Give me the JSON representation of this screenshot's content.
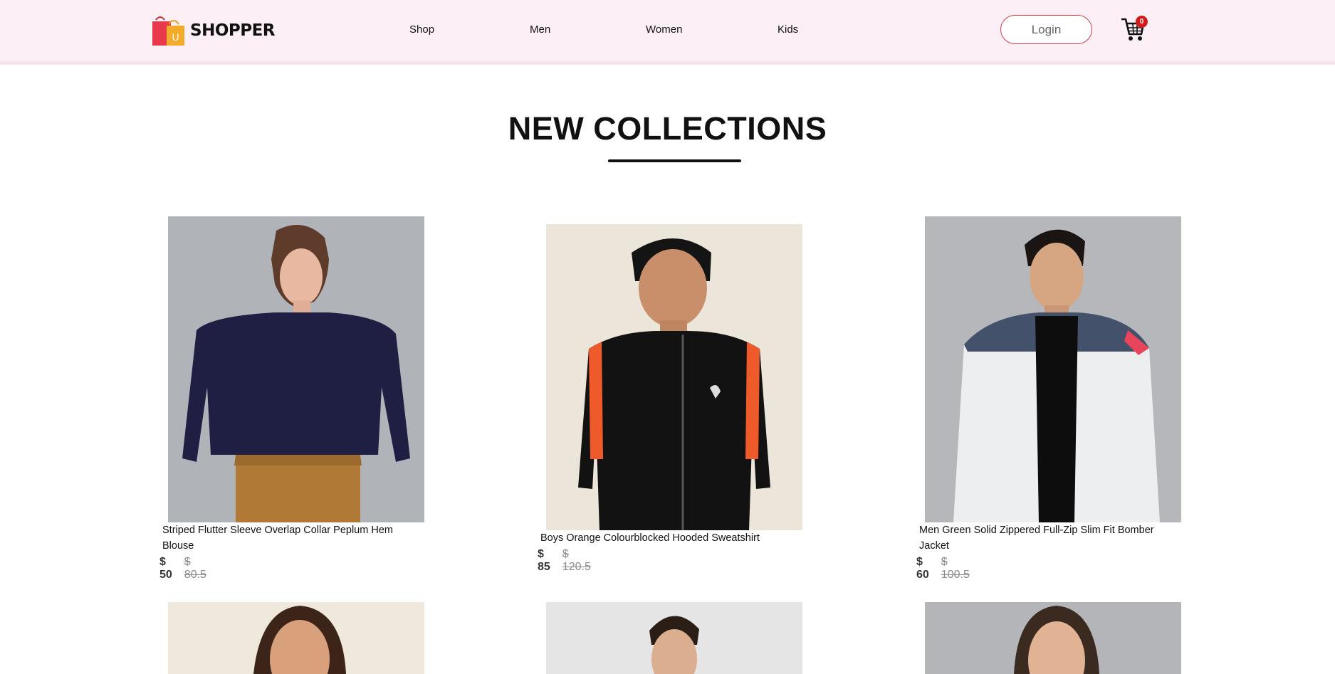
{
  "brand": {
    "name": "SHOPPER",
    "logo_letter": "U"
  },
  "nav": {
    "items": [
      "Shop",
      "Men",
      "Women",
      "Kids"
    ]
  },
  "auth": {
    "login_label": "Login"
  },
  "cart": {
    "count": "0"
  },
  "section": {
    "title": "NEW COLLECTIONS"
  },
  "products": [
    {
      "name": "Striped Flutter Sleeve Overlap Collar Peplum Hem Blouse",
      "new_price": "$ 50",
      "old_price": "$ 80.5"
    },
    {
      "name": "Boys Orange Colourblocked Hooded Sweatshirt",
      "new_price": "$ 85",
      "old_price": "$ 120.5"
    },
    {
      "name": "Men Green Solid Zippered Full-Zip Slim Fit Bomber Jacket",
      "new_price": "$ 60",
      "old_price": "$ 100.5"
    }
  ],
  "colors": {
    "navbar_bg": "#fcf0f6",
    "login_border": "#e0394a",
    "badge": "#d11b1b",
    "heading": "#111111",
    "old_price": "#8b8b8b"
  }
}
